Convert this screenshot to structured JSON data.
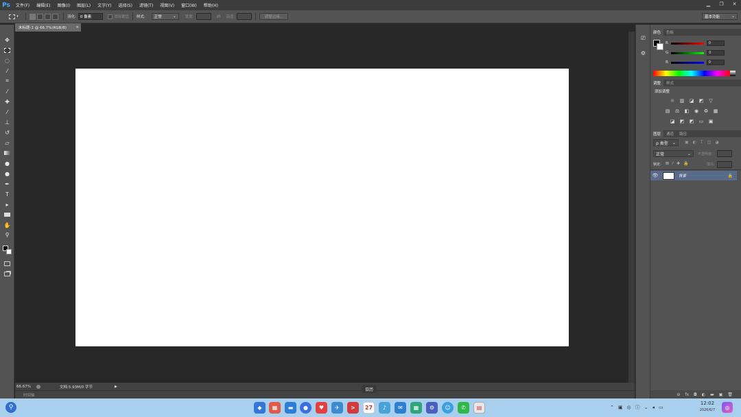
{
  "menubar": {
    "logo": "Ps",
    "items": [
      "文件(F)",
      "编辑(E)",
      "图像(I)",
      "图层(L)",
      "文字(Y)",
      "选择(S)",
      "滤镜(T)",
      "视图(V)",
      "窗口(W)",
      "帮助(H)"
    ]
  },
  "options": {
    "feather_label": "羽化:",
    "feather_value": "0 像素",
    "antialias_label": "消除锯齿",
    "style_label": "样式:",
    "style_value": "正常",
    "width_label": "宽度:",
    "height_label": "高度:",
    "refine_edge": "调整边缘...",
    "workspace": "基本功能"
  },
  "document": {
    "tab_title": "未标题-1 @ 66.7%(RGB/8)",
    "tab_close": "×",
    "zoom": "66.67%",
    "doc_info": "文档:5.93M/0 字节",
    "timeline_label": "时间轴"
  },
  "panels": {
    "color_tabs": [
      "颜色",
      "色板"
    ],
    "r_label": "R",
    "r_value": "0",
    "g_label": "G",
    "g_value": "0",
    "b_label": "B",
    "b_value": "0",
    "adjust_tabs": [
      "调整",
      "样式"
    ],
    "add_adjustment": "添加调整",
    "layer_tabs": [
      "图层",
      "通道",
      "路径"
    ],
    "filter_kind": "ρ 类型",
    "blend_mode": "正常",
    "opacity_label": "不透明度:",
    "lock_label": "锁定:",
    "fill_label": "填充:",
    "layer_name": "背景"
  },
  "taskbar": {
    "time": "12:02",
    "date": "2026/6/7",
    "calendar_day": "27",
    "tooltip": "日历"
  },
  "colors": {
    "accent": "#4aa8ff",
    "taskbar": "#a9cfef",
    "canvas": "#ffffff",
    "selected_layer": "#586b8a"
  }
}
